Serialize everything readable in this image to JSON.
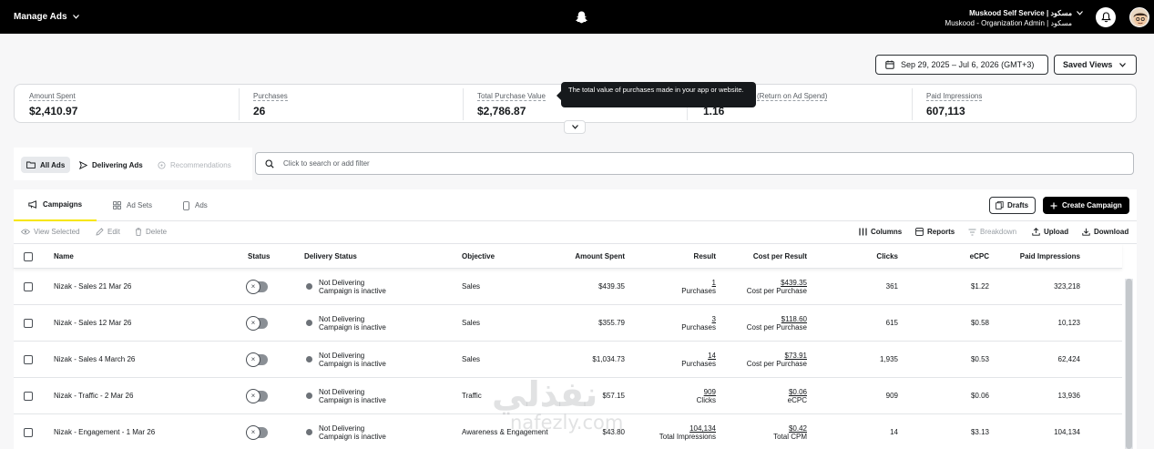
{
  "topbar": {
    "app_menu": "Manage Ads",
    "account_line1": "Muskood Self Service | مسكود",
    "account_line2": "Muskood - Organization Admin | مسكود"
  },
  "header": {
    "date_range": "Sep 29, 2025 – Jul 6, 2026 (GMT+3)",
    "saved_views": "Saved Views"
  },
  "metrics": [
    {
      "label": "Amount Spent",
      "value": "$2,410.97"
    },
    {
      "label": "Purchases",
      "value": "26"
    },
    {
      "label": "Total Purchase Value",
      "value": "$2,786.87"
    },
    {
      "label": "(Return on Ad Spend)",
      "value": "1.16"
    },
    {
      "label": "Paid Impressions",
      "value": "607,113"
    }
  ],
  "tooltip": "The total value of purchases made in your app or website.",
  "filters": {
    "all_ads": "All Ads",
    "delivering_ads": "Delivering Ads",
    "recommendations": "Recommendations",
    "search_placeholder": "Click to search or add filter"
  },
  "tabs": [
    "Campaigns",
    "Ad Sets",
    "Ads"
  ],
  "actions": {
    "drafts": "Drafts",
    "create": "Create Campaign"
  },
  "toolbar": {
    "view_selected": "View Selected",
    "edit": "Edit",
    "delete": "Delete",
    "columns": "Columns",
    "reports": "Reports",
    "breakdown": "Breakdown",
    "upload": "Upload",
    "download": "Download"
  },
  "table": {
    "headers": {
      "name": "Name",
      "status": "Status",
      "delivery": "Delivery Status",
      "objective": "Objective",
      "spent": "Amount Spent",
      "result": "Result",
      "cpr": "Cost per Result",
      "clicks": "Clicks",
      "ecpc": "eCPC",
      "impressions": "Paid Impressions"
    },
    "rows": [
      {
        "name": "Nizak - Sales 21 Mar 26",
        "delivery1": "Not Delivering",
        "delivery2": "Campaign is inactive",
        "objective": "Sales",
        "spent": "$439.35",
        "result": "1",
        "result_label": "Purchases",
        "cpr": "$439.35",
        "cpr_label": "Cost per Purchase",
        "clicks": "361",
        "ecpc": "$1.22",
        "impressions": "323,218"
      },
      {
        "name": "Nizak - Sales 12 Mar 26",
        "delivery1": "Not Delivering",
        "delivery2": "Campaign is inactive",
        "objective": "Sales",
        "spent": "$355.79",
        "result": "3",
        "result_label": "Purchases",
        "cpr": "$118.60",
        "cpr_label": "Cost per Purchase",
        "clicks": "615",
        "ecpc": "$0.58",
        "impressions": "10,123"
      },
      {
        "name": "Nizak - Sales 4 March 26",
        "delivery1": "Not Delivering",
        "delivery2": "Campaign is inactive",
        "objective": "Sales",
        "spent": "$1,034.73",
        "result": "14",
        "result_label": "Purchases",
        "cpr": "$73.91",
        "cpr_label": "Cost per Purchase",
        "clicks": "1,935",
        "ecpc": "$0.53",
        "impressions": "62,424"
      },
      {
        "name": "Nizak - Traffic - 2 Mar 26",
        "delivery1": "Not Delivering",
        "delivery2": "Campaign is inactive",
        "objective": "Traffic",
        "spent": "$57.15",
        "result": "909",
        "result_label": "Clicks",
        "cpr": "$0.06",
        "cpr_label": "eCPC",
        "clicks": "909",
        "ecpc": "$0.06",
        "impressions": "13,936"
      },
      {
        "name": "Nizak - Engagement - 1 Mar 26",
        "delivery1": "Not Delivering",
        "delivery2": "Campaign is inactive",
        "objective": "Awareness & Engagement",
        "spent": "$43.80",
        "result": "104,134",
        "result_label": "Total Impressions",
        "cpr": "$0.42",
        "cpr_label": "Total CPM",
        "clicks": "14",
        "ecpc": "$3.13",
        "impressions": "104,134"
      }
    ]
  },
  "watermark": {
    "line1": "نفذلي",
    "line2": "nafezly.com"
  }
}
